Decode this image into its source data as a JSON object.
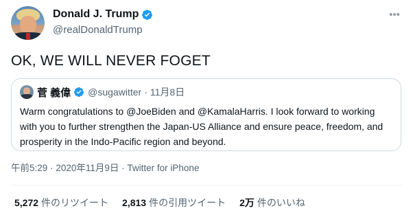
{
  "author": {
    "display_name": "Donald J. Trump",
    "handle": "@realDonaldTrump",
    "verified": true
  },
  "tweet": {
    "text": "OK, WE WILL NEVER FOGET"
  },
  "quoted_tweet": {
    "display_name": "菅 義偉",
    "handle": "@sugawitter",
    "separator": "·",
    "date": "11月8日",
    "verified": true,
    "text": "Warm congratulations to @JoeBiden and @KamalaHarris. I look forward to working with you to further strengthen the Japan-US Alliance and ensure peace, freedom, and prosperity in the Indo-Pacific region and beyond."
  },
  "meta": {
    "time": "午前5:29",
    "separator": "·",
    "date": "2020年11月9日",
    "separator2": "·",
    "source": "Twitter for iPhone"
  },
  "stats": {
    "retweets": {
      "count": "5,272",
      "label": "件のリツイート"
    },
    "quotes": {
      "count": "2,813",
      "label": "件の引用ツイート"
    },
    "likes": {
      "count": "2万",
      "label": "件のいいね"
    }
  },
  "icons": {
    "verified": "verified-badge-icon",
    "more": "more-options-icon"
  },
  "colors": {
    "verified_blue": "#1d9bf0",
    "secondary_text": "#536471",
    "border": "#cfd9de"
  }
}
